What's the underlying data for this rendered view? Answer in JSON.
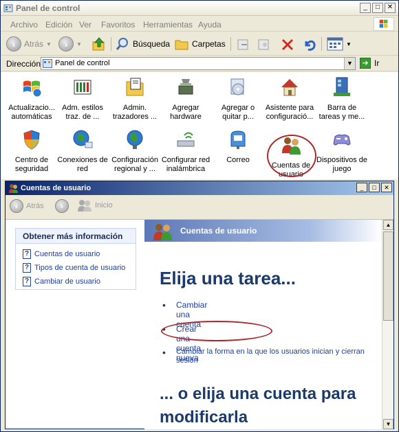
{
  "window": {
    "title": "Panel de control",
    "controls": {
      "minimize": "_",
      "maximize": "□",
      "close": "✕"
    }
  },
  "menu": [
    "Archivo",
    "Edición",
    "Ver",
    "Favoritos",
    "Herramientas",
    "Ayuda"
  ],
  "toolbar": {
    "back": "Atrás",
    "search": "Búsqueda",
    "folders": "Carpetas"
  },
  "address": {
    "label": "Dirección",
    "value": "Panel de control",
    "go": "Ir"
  },
  "icons": [
    {
      "label1": "Actualizacio...",
      "label2": "automáticas",
      "icon": "windows-update-icon"
    },
    {
      "label1": "Adm. estilos",
      "label2": "traz. de ...",
      "icon": "print-styles-icon"
    },
    {
      "label1": "Admin.",
      "label2": "trazadores ...",
      "icon": "plotter-admin-icon"
    },
    {
      "label1": "Agregar",
      "label2": "hardware",
      "icon": "add-hardware-icon"
    },
    {
      "label1": "Agregar o",
      "label2": "quitar p...",
      "icon": "add-remove-programs-icon"
    },
    {
      "label1": "Asistente para",
      "label2": "configuració...",
      "icon": "network-setup-wizard-icon"
    },
    {
      "label1": "Barra de",
      "label2": "tareas y me...",
      "icon": "taskbar-icon"
    },
    {
      "label1": "Centro de",
      "label2": "seguridad",
      "icon": "security-center-icon"
    },
    {
      "label1": "Conexiones de",
      "label2": "red",
      "icon": "network-connections-icon"
    },
    {
      "label1": "Configuración",
      "label2": "regional y ...",
      "icon": "regional-settings-icon"
    },
    {
      "label1": "Configurar red",
      "label2": "inalámbrica",
      "icon": "wireless-network-icon"
    },
    {
      "label1": "Correo",
      "label2": "",
      "icon": "mail-icon"
    },
    {
      "label1": "Cuentas de",
      "label2": "usuario",
      "icon": "user-accounts-icon"
    },
    {
      "label1": "Dispositivos de",
      "label2": "juego",
      "icon": "game-controllers-icon"
    }
  ],
  "inner": {
    "title": "Cuentas de usuario",
    "nav": {
      "back": "Atrás",
      "home": "Inicio"
    },
    "info": {
      "heading": "Obtener más información",
      "links": [
        "Cuentas de usuario",
        "Tipos de cuenta de usuario",
        "Cambiar de usuario"
      ]
    },
    "band_title": "Cuentas de usuario",
    "task_heading": "Elija una tarea...",
    "tasks": [
      "Cambiar una cuenta",
      "Crear una cuenta nueva",
      "Cambiar la forma en la que los usuarios inician y cierran",
      "sesión"
    ],
    "or_heading_1": "... o elija una cuenta para",
    "or_heading_2": "modificarla"
  }
}
